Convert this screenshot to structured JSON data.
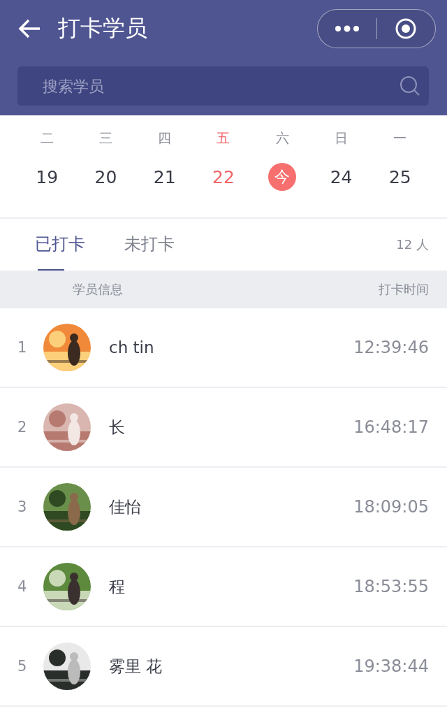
{
  "header": {
    "title": "打卡学员",
    "search": {
      "placeholder": "搜索学员"
    }
  },
  "calendar": [
    {
      "weekday": "二",
      "day": "19",
      "selected": false,
      "today": false
    },
    {
      "weekday": "三",
      "day": "20",
      "selected": false,
      "today": false
    },
    {
      "weekday": "四",
      "day": "21",
      "selected": false,
      "today": false
    },
    {
      "weekday": "五",
      "day": "22",
      "selected": true,
      "today": false
    },
    {
      "weekday": "六",
      "day": "今",
      "selected": false,
      "today": true
    },
    {
      "weekday": "日",
      "day": "24",
      "selected": false,
      "today": false
    },
    {
      "weekday": "一",
      "day": "25",
      "selected": false,
      "today": false
    }
  ],
  "tabs": [
    {
      "label": "已打卡",
      "selected": true
    },
    {
      "label": "未打卡",
      "selected": false
    }
  ],
  "count": "12 人",
  "table": {
    "columns": [
      "学员信息",
      "打卡时间"
    ],
    "rows": [
      {
        "index": "1",
        "name": "ch tin",
        "time": "12:39:46"
      },
      {
        "index": "2",
        "name": "长",
        "time": "16:48:17"
      },
      {
        "index": "3",
        "name": "佳怡",
        "time": "18:09:05"
      },
      {
        "index": "4",
        "name": "程",
        "time": "18:53:55"
      },
      {
        "index": "5",
        "name": "雾里 花",
        "time": "19:38:44"
      }
    ]
  }
}
